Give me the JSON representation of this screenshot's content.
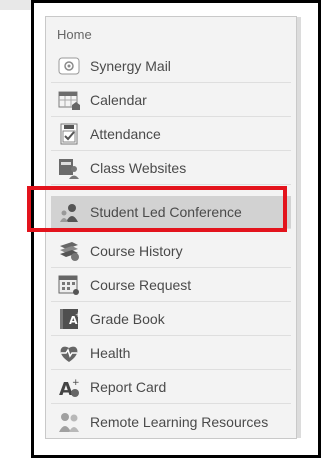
{
  "nav": {
    "home_label": "Home",
    "items": [
      {
        "label": "Synergy Mail",
        "icon": "mail-icon"
      },
      {
        "label": "Calendar",
        "icon": "calendar-icon"
      },
      {
        "label": "Attendance",
        "icon": "attendance-checkbox-icon"
      },
      {
        "label": "Class Websites",
        "icon": "class-websites-icon"
      },
      {
        "label": "Student Led Conference",
        "icon": "student-icon",
        "active": true
      },
      {
        "label": "Course History",
        "icon": "books-icon"
      },
      {
        "label": "Course Request",
        "icon": "course-request-icon"
      },
      {
        "label": "Grade Book",
        "icon": "grade-book-icon"
      },
      {
        "label": "Health",
        "icon": "heart-pulse-icon"
      },
      {
        "label": "Report Card",
        "icon": "report-card-icon"
      },
      {
        "label": "Remote Learning Resources",
        "icon": "group-icon"
      }
    ]
  },
  "colors": {
    "highlight": "#e3131c",
    "active_bg": "#d2d2d2",
    "panel_bg": "#f3f3f3"
  }
}
